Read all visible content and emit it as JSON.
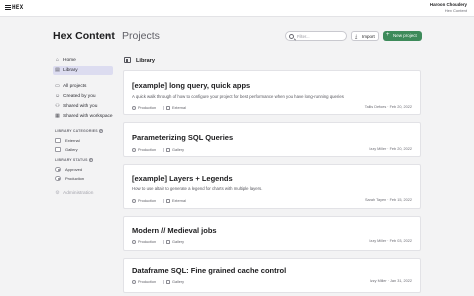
{
  "app": {
    "logo_text": "HEX"
  },
  "user": {
    "name": "Haroon Choudery",
    "org": "Hex Content"
  },
  "header": {
    "workspace": "Hex Content",
    "page_title": "Projects",
    "filter_placeholder": "Filter...",
    "import_label": "Import",
    "new_project_label": "New project"
  },
  "sidebar": {
    "top_items": [
      {
        "label": "Home",
        "icon": "home-icon"
      },
      {
        "label": "Library",
        "icon": "library-icon",
        "active": true
      }
    ],
    "project_items": [
      {
        "label": "All projects",
        "icon": "folder-icon"
      },
      {
        "label": "Created by you",
        "icon": "user-icon"
      },
      {
        "label": "Shared with you",
        "icon": "people-icon"
      },
      {
        "label": "Shared with workspace",
        "icon": "workspace-icon"
      }
    ],
    "categories_label": "LIBRARY CATEGORIES",
    "categories": [
      "External",
      "Gallery"
    ],
    "status_label": "LIBRARY STATUS",
    "statuses": [
      "Approved",
      "Production"
    ],
    "admin_label": "Administration"
  },
  "content": {
    "section_title": "Library",
    "cards": [
      {
        "title": "[example] long query, quick apps",
        "description": "A quick walk through of how to configure your project for best performance when you have long-running queries",
        "status": "Production",
        "category": "External",
        "author": "Tallis Defoes",
        "date": "Feb 20, 2022"
      },
      {
        "title": "Parameterizing SQL Queries",
        "description": "",
        "status": "Production",
        "category": "Gallery",
        "author": "Izzy Miller",
        "date": "Feb 20, 2022"
      },
      {
        "title": "[example] Layers + Legends",
        "description": "How to use altair to generate a legend for charts with multiple layers.",
        "status": "Production",
        "category": "External",
        "author": "Sarah Tayen",
        "date": "Feb 15, 2022"
      },
      {
        "title": "Modern // Medieval jobs",
        "description": "",
        "status": "Production",
        "category": "Gallery",
        "author": "Izzy Miller",
        "date": "Feb 03, 2022"
      },
      {
        "title": "Dataframe SQL: Fine grained cache control",
        "description": "",
        "status": "Production",
        "category": "Gallery",
        "author": "Izzy Miller",
        "date": "Jan 31, 2022"
      }
    ]
  },
  "colors": {
    "accent": "#3d8a5a",
    "active_nav": "#dcdcf0",
    "background": "#f3f3f4"
  }
}
